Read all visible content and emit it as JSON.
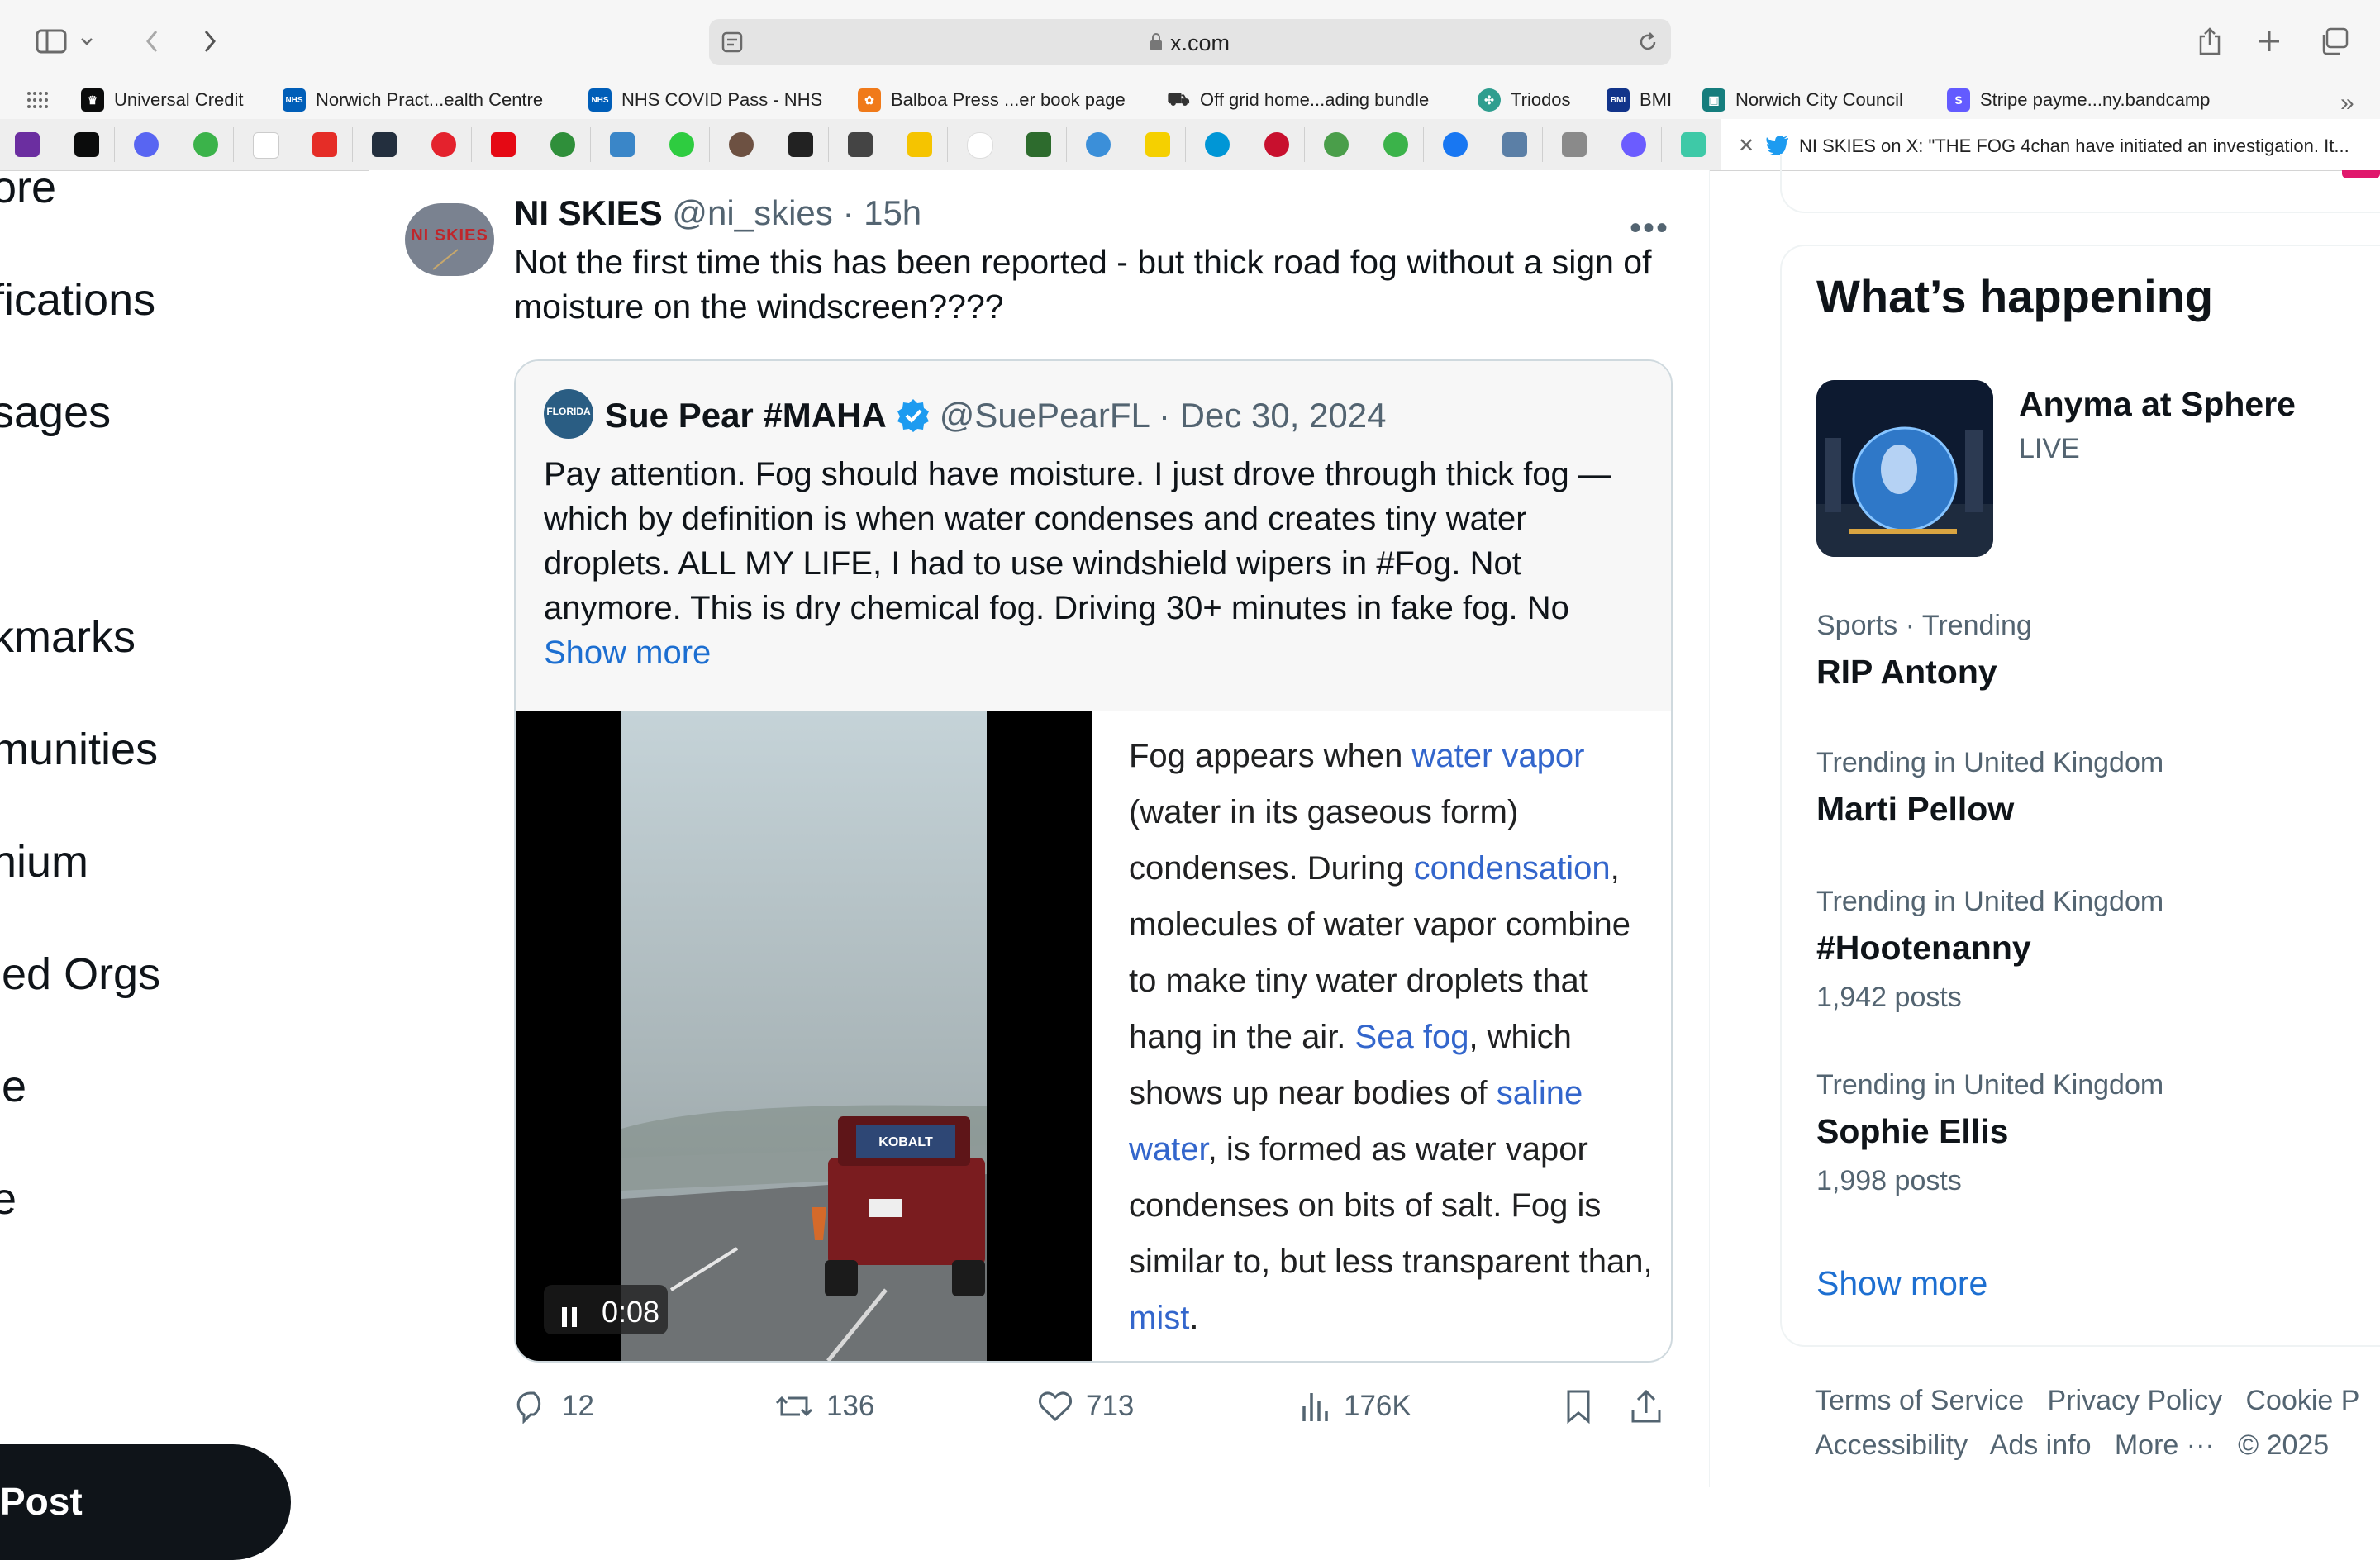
{
  "browser": {
    "url": "x.com",
    "bookmarks": [
      {
        "label": "Universal Credit",
        "color": "#0b0c0c",
        "glyph": "♛"
      },
      {
        "label": "Norwich Pract...ealth Centre",
        "color": "#005eb8",
        "glyph": "NHS"
      },
      {
        "label": "NHS COVID Pass - NHS",
        "color": "#005eb8",
        "glyph": "NHS"
      },
      {
        "label": "Balboa Press ...er book page",
        "color": "#f07a1a",
        "glyph": "✿"
      },
      {
        "label": "Off grid home...ading bundle",
        "color": "#333333",
        "glyph": "🛒"
      },
      {
        "label": "Triodos",
        "color": "#2f9e8f",
        "glyph": "✣"
      },
      {
        "label": "BMI",
        "color": "#12348a",
        "glyph": "BMI"
      },
      {
        "label": "Norwich City Council",
        "color": "#157d7d",
        "glyph": "▣"
      },
      {
        "label": "Stripe payme...ny.bandcamp",
        "color": "#635bff",
        "glyph": "S"
      }
    ],
    "active_tab_title": "NI SKIES on X: \"THE FOG 4chan have initiated an investigation. It..."
  },
  "left_nav": {
    "items": [
      "ore",
      "fications",
      "sages",
      "kmarks",
      "munities",
      "nium",
      "ied Orgs",
      "le",
      "e"
    ],
    "post_label": "Post"
  },
  "tweet": {
    "display_name": "NI SKIES",
    "handle": "@ni_skies",
    "time": "· 15h",
    "more": "•••",
    "avatar_text": "NI SKIES",
    "text": "Not the first time this has been reported - but thick road fog without a sign of moisture on the windscreen????",
    "quote": {
      "display_name": "Sue Pear #MAHA",
      "handle": "@SuePearFL",
      "date": "· Dec 30, 2024",
      "avatar_text": "FLORIDA",
      "text": "Pay attention. Fog should have moisture. I just drove through thick fog —which by definition is when water condenses and creates tiny water droplets. ALL MY LIFE, I had to use windshield wipers in #Fog. Not anymore. This is dry chemical fog. Driving 30+ minutes in fake fog. No",
      "show_more": "Show more",
      "video_time": "0:08",
      "truck_text": "KOBALT",
      "wiki": {
        "t1": "Fog appears when ",
        "l1": "water vapor",
        "t2": " (water in its gaseous form) condenses. During ",
        "l2": "condensation",
        "t3": ", molecules of water vapor combine to make tiny water droplets that hang in the air. ",
        "l3": "Sea fog",
        "t4": ", which shows up near bodies of ",
        "l4": "saline water",
        "t5": ", is formed as water vapor condenses on bits of salt. Fog is similar to, but less transparent than, ",
        "l5": "mist",
        "t6": "."
      }
    },
    "stats": {
      "replies": "12",
      "reposts": "136",
      "likes": "713",
      "views": "176K"
    }
  },
  "sidebar": {
    "heading": "What’s happening",
    "trends": [
      {
        "title": "Anyma at Sphere",
        "meta": "LIVE"
      },
      {
        "meta": "Sports · Trending",
        "title": "RIP Antony"
      },
      {
        "meta": "Trending in United Kingdom",
        "title": "Marti Pellow"
      },
      {
        "meta": "Trending in United Kingdom",
        "title": "#Hootenanny",
        "posts": "1,942 posts"
      },
      {
        "meta": "Trending in United Kingdom",
        "title": "Sophie Ellis",
        "posts": "1,998 posts"
      }
    ],
    "show_more": "Show more",
    "footer": {
      "terms": "Terms of Service",
      "privacy": "Privacy Policy",
      "cookie": "Cookie P",
      "accessibility": "Accessibility",
      "ads": "Ads info",
      "more": "More ···",
      "copyright": "© 2025"
    }
  },
  "colors": {
    "link": "#1d6fd1",
    "wiki_link": "#3366cc",
    "verified": "#1d9bf0",
    "post_button": "#0f1419"
  }
}
